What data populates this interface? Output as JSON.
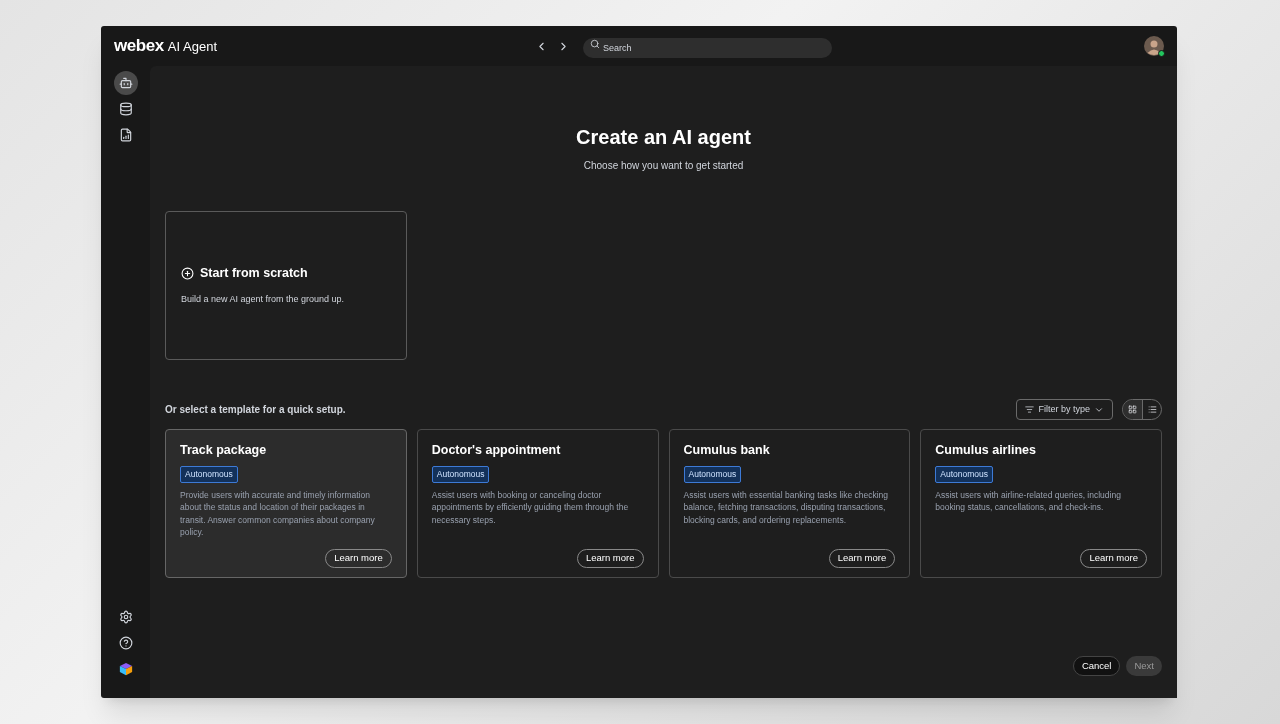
{
  "app": {
    "brand": "webex",
    "title": "AI Agent"
  },
  "search": {
    "placeholder": "Search"
  },
  "user": {
    "online": true
  },
  "sidebar": {
    "items": [
      {
        "kind": "agent",
        "selected": true
      },
      {
        "kind": "database",
        "selected": false
      },
      {
        "kind": "report",
        "selected": false
      }
    ],
    "bottom": [
      {
        "kind": "settings"
      },
      {
        "kind": "help"
      },
      {
        "kind": "cube"
      }
    ]
  },
  "heading": {
    "title": "Create an AI agent",
    "subtitle": "Choose how you want to get started"
  },
  "scratch": {
    "title": "Start from scratch",
    "description": "Build a new AI agent from the ground up."
  },
  "templates": {
    "label": "Or select a template for a quick setup.",
    "filter": "Filter by type",
    "view": [
      {
        "kind": "grid",
        "selected": true
      },
      {
        "kind": "list",
        "selected": false
      }
    ],
    "cards": [
      {
        "title": "Track package",
        "tag": "Autonomous",
        "description": "Provide users with accurate and timely information about the status and location of their packages in transit. Answer common companies about company policy.",
        "action": "Learn more",
        "selected": true
      },
      {
        "title": "Doctor's appointment",
        "tag": "Autonomous",
        "description": "Assist users with booking or canceling doctor appointments by efficiently guiding them through the necessary steps.",
        "action": "Learn more",
        "selected": false
      },
      {
        "title": "Cumulus bank",
        "tag": "Autonomous",
        "description": "Assist users with essential banking tasks like checking balance, fetching transactions, disputing transactions, blocking cards, and ordering replacements.",
        "action": "Learn more",
        "selected": false
      },
      {
        "title": "Cumulus airlines",
        "tag": "Autonomous",
        "description": "Assist users with airline-related queries, including booking status, cancellations, and check-ins.",
        "action": "Learn more",
        "selected": false
      }
    ]
  },
  "footer": {
    "buttons": [
      {
        "label": "Cancel",
        "disabled": false
      },
      {
        "label": "Next",
        "disabled": true
      }
    ]
  }
}
